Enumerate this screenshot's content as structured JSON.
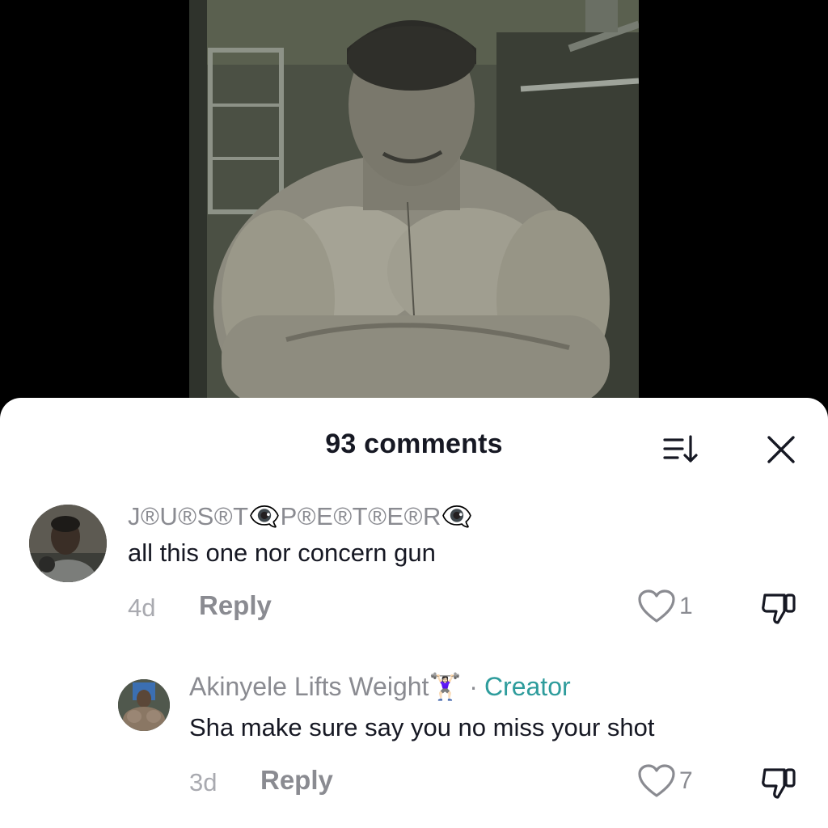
{
  "video": {
    "description_icon": "video-frame"
  },
  "comments_panel": {
    "title": "93 comments",
    "sort_icon": "sort-icon",
    "close_icon": "close-icon"
  },
  "comments": [
    {
      "username": "J®U®S®T👁‍🗨P®E®T®E®R👁‍🗨",
      "text": "all this one nor concern gun",
      "time": "4d",
      "reply_label": "Reply",
      "likes": "1"
    },
    {
      "username": "Akinyele Lifts Weight🏋🏻‍♀️",
      "separator": "·",
      "badge": "Creator",
      "text": "Sha make sure say you no miss your shot",
      "time": "3d",
      "reply_label": "Reply",
      "likes": "7"
    }
  ],
  "colors": {
    "creator_badge": "#2e9c9c",
    "text": "#161823",
    "muted": "#8a8b91"
  }
}
